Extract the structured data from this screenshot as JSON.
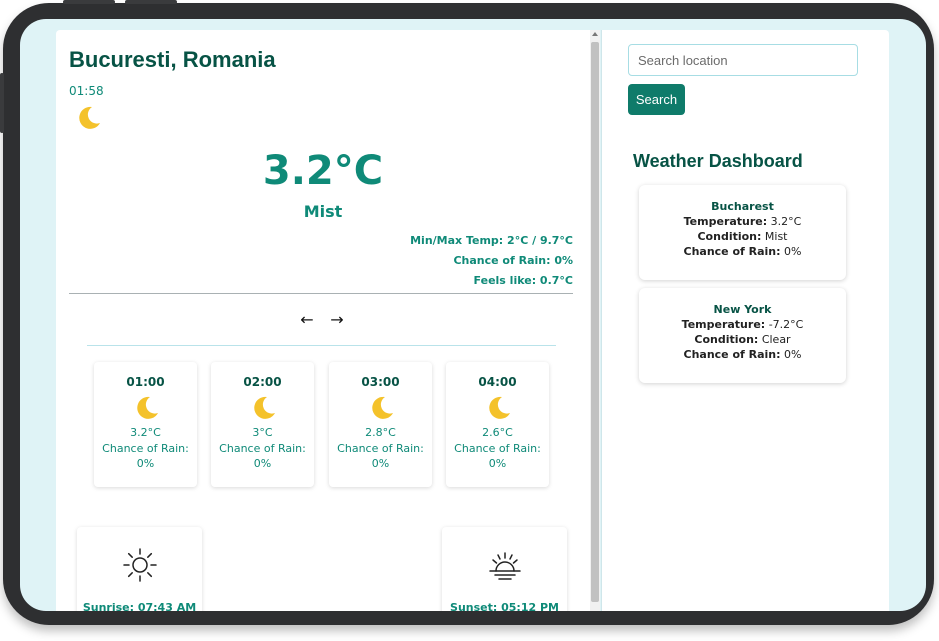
{
  "location": {
    "city": "Bucuresti, Romania",
    "local_time": "01:58",
    "icon": "crescent-moon-icon"
  },
  "current": {
    "temperature": "3.2°C",
    "condition": "Mist",
    "minmax": "Min/Max Temp: 2°C / 9.7°C",
    "chance_of_rain": "Chance of Rain: 0%",
    "feels_like": "Feels like: 0.7°C"
  },
  "navigation": {
    "prev_label": "←",
    "next_label": "→"
  },
  "hourly": [
    {
      "time": "01:00",
      "icon": "crescent-moon-icon",
      "temp": "3.2°C",
      "rain_label": "Chance of Rain:",
      "rain_value": "0%"
    },
    {
      "time": "02:00",
      "icon": "crescent-moon-icon",
      "temp": "3°C",
      "rain_label": "Chance of Rain:",
      "rain_value": "0%"
    },
    {
      "time": "03:00",
      "icon": "crescent-moon-icon",
      "temp": "2.8°C",
      "rain_label": "Chance of Rain:",
      "rain_value": "0%"
    },
    {
      "time": "04:00",
      "icon": "crescent-moon-icon",
      "temp": "2.6°C",
      "rain_label": "Chance of Rain:",
      "rain_value": "0%"
    }
  ],
  "sun": {
    "sunrise_icon": "sunrise-icon",
    "sunrise_text": "Sunrise: 07:43 AM",
    "sunset_icon": "sunset-icon",
    "sunset_text": "Sunset: 05:12 PM"
  },
  "search": {
    "placeholder": "Search location",
    "value": "",
    "button_label": "Search"
  },
  "dashboard": {
    "title": "Weather Dashboard",
    "cities": [
      {
        "name": "Bucharest",
        "temp_label": "Temperature:",
        "temp": "3.2°C",
        "cond_label": "Condition:",
        "cond": "Mist",
        "rain_label": "Chance of Rain:",
        "rain": "0%"
      },
      {
        "name": "New York",
        "temp_label": "Temperature:",
        "temp": "-7.2°C",
        "cond_label": "Condition:",
        "cond": "Clear",
        "rain_label": "Chance of Rain:",
        "rain": "0%"
      }
    ]
  },
  "colors": {
    "accent": "#0f8a78",
    "dark_teal": "#075345",
    "button": "#0f7b6a",
    "moon": "#f4c22b",
    "screen_bg": "#dff3f6",
    "frame": "#2e2f31"
  }
}
